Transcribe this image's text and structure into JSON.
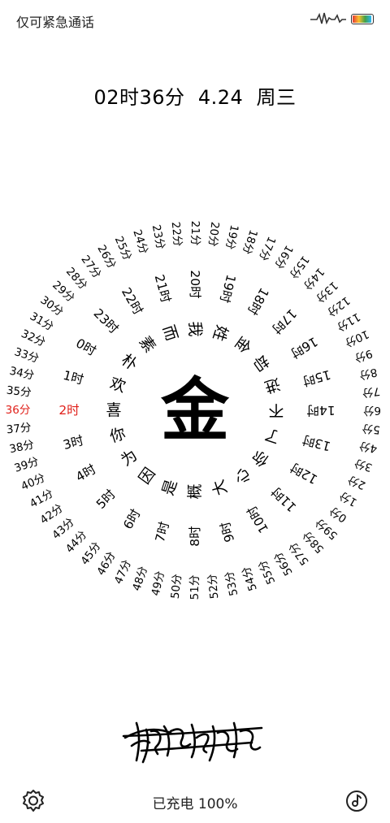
{
  "status_bar": {
    "carrier_text": "仅可紧急通话",
    "battery_level": 1.0
  },
  "header": {
    "datetime": "02时36分  4.24  周三"
  },
  "clock": {
    "center_char": "金",
    "current_minute": 36,
    "current_hour": 2,
    "active_color": "#e0201a",
    "minutes": [
      "0分",
      "1分",
      "2分",
      "3分",
      "4分",
      "5分",
      "6分",
      "7分",
      "8分",
      "9分",
      "10分",
      "11分",
      "12分",
      "13分",
      "14分",
      "15分",
      "16分",
      "17分",
      "18分",
      "19分",
      "20分",
      "21分",
      "22分",
      "23分",
      "24分",
      "25分",
      "26分",
      "27分",
      "28分",
      "29分",
      "30分",
      "31分",
      "32分",
      "33分",
      "34分",
      "35分",
      "36分",
      "37分",
      "38分",
      "39分",
      "40分",
      "41分",
      "42分",
      "43分",
      "44分",
      "45分",
      "46分",
      "47分",
      "48分",
      "49分",
      "50分",
      "51分",
      "52分",
      "53分",
      "54分",
      "55分",
      "56分",
      "57分",
      "58分",
      "59分"
    ],
    "hours": [
      "0时",
      "1时",
      "2时",
      "3时",
      "4时",
      "5时",
      "6时",
      "7时",
      "8时",
      "9时",
      "10时",
      "11时",
      "12时",
      "13时",
      "14时",
      "15时",
      "16时",
      "17时",
      "18时",
      "19时",
      "20时",
      "21时",
      "22时",
      "23时"
    ],
    "phrase": [
      "我",
      "姓",
      "金",
      "却",
      "进",
      "不",
      "了",
      "你",
      "心",
      "大",
      "概",
      "是",
      "因",
      "为",
      "你",
      "喜",
      "欢",
      "朴",
      "素",
      "而"
    ]
  },
  "footer": {
    "charge_text": "已充电 100%"
  },
  "icons": {
    "settings": "gear-icon",
    "music": "music-disc-icon",
    "signal": "pulse-signal-icon",
    "battery": "battery-icon"
  }
}
